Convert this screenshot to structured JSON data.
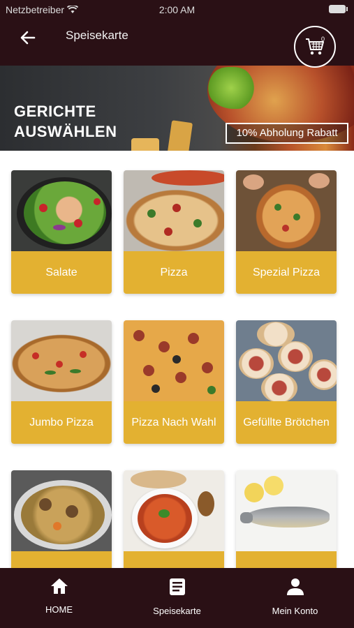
{
  "status_bar": {
    "carrier": "Netzbetreiber",
    "time": "2:00 AM"
  },
  "app_bar": {
    "title": "Speisekarte",
    "cart_count": "0"
  },
  "banner": {
    "title_line1": "GERICHTE",
    "title_line2": "AUSWÄHLEN",
    "promo": "10% Abholung Rabatt"
  },
  "categories": [
    {
      "label": "Salate",
      "icon": "salad"
    },
    {
      "label": "Pizza",
      "icon": "pizza"
    },
    {
      "label": "Spezial Pizza",
      "icon": "special-pizza"
    },
    {
      "label": "Jumbo Pizza",
      "icon": "jumbo-pizza"
    },
    {
      "label": "Pizza Nach Wahl",
      "icon": "custom-pizza"
    },
    {
      "label": "Gefüllte Brötchen",
      "icon": "filled-rolls"
    },
    {
      "label": "",
      "icon": "soup"
    },
    {
      "label": "",
      "icon": "sauce"
    },
    {
      "label": "",
      "icon": "fish"
    }
  ],
  "bottom_nav": [
    {
      "label": "HOME",
      "icon": "home-icon"
    },
    {
      "label": "Speisekarte",
      "icon": "menu-book-icon"
    },
    {
      "label": "Mein Konto",
      "icon": "account-icon"
    }
  ],
  "colors": {
    "dark": "#2a1015",
    "accent": "#e3b131"
  }
}
